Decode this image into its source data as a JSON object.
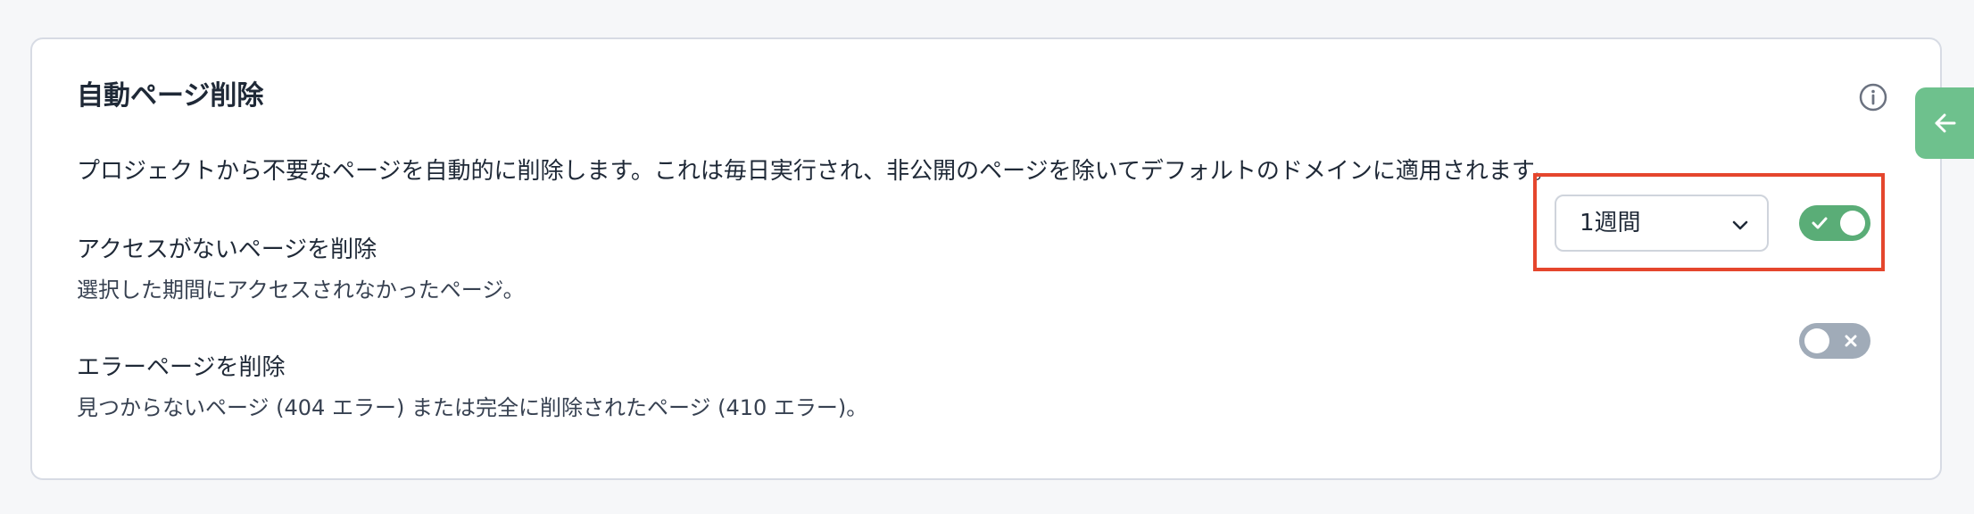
{
  "colors": {
    "toggle_on": "#5aad77",
    "toggle_off": "#a0abb8",
    "side_tab": "#6ec18d",
    "highlight": "#e5462d"
  },
  "section": {
    "title": "自動ページ削除",
    "description": "プロジェクトから不要なページを自動的に削除します。これは毎日実行され、非公開のページを除いてデフォルトのドメインに適用されます。",
    "info_icon": "info-icon"
  },
  "settings": [
    {
      "title": "アクセスがないページを削除",
      "description": "選択した期間にアクセスされなかったページ。",
      "period_select": {
        "selected": "1週間",
        "icon": "chevron-down-icon"
      },
      "enabled": true
    },
    {
      "title": "エラーページを削除",
      "description": "見つからないページ (404 エラー) または完全に削除されたページ (410 エラー)。",
      "enabled": false
    }
  ],
  "side_tab": {
    "icon": "arrow-left-icon"
  }
}
